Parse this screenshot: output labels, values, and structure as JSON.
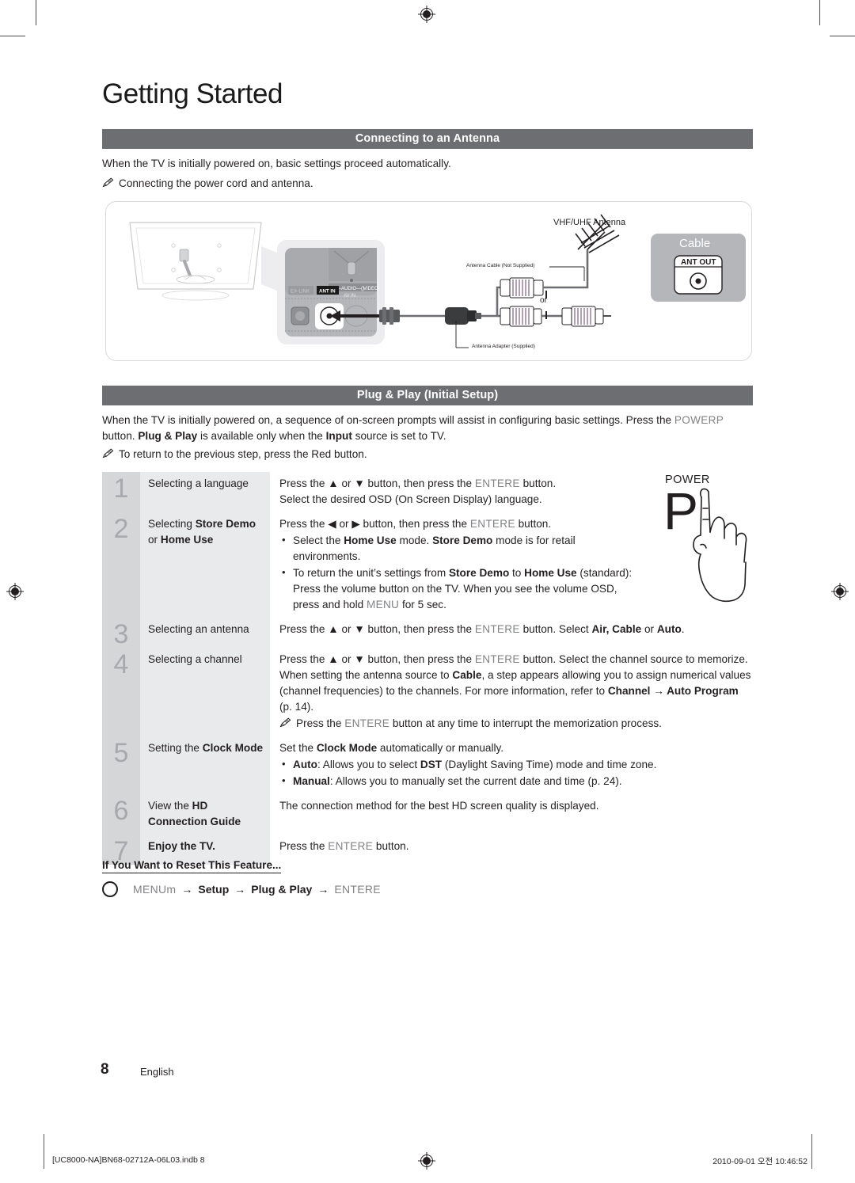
{
  "page": {
    "title": "Getting Started",
    "number": "8",
    "language": "English"
  },
  "antenna_section": {
    "header": "Connecting to an Antenna",
    "intro": "When the TV is initially powered on, basic settings proceed automatically.",
    "note": "Connecting the power cord and antenna.",
    "diagram": {
      "antenna_label": "VHF/UHF Antenna",
      "cable_not_supplied": "Antenna Cable (Not Supplied)",
      "adapter_supplied": "Antenna Adapter (Supplied)",
      "or_label": "or",
      "cable_box_title": "Cable",
      "ant_out_label": "ANT OUT",
      "port_ex_link": "EX-LINK",
      "port_ant_in": "ANT IN",
      "port_audio": "AUDIO",
      "port_video": "VIDEO",
      "port_av_in": "AV IN"
    }
  },
  "plugplay_section": {
    "header": "Plug & Play (Initial Setup)",
    "intro_1": "When the TV is initially powered on, a sequence of on-screen prompts will assist in configuring basic settings. Press the",
    "intro_power_key": "POWERP",
    "intro_2": "button.",
    "intro_bold_plugplay": "Plug & Play",
    "intro_3": "is available only when the",
    "intro_bold_input": "Input",
    "intro_4": "source is set to TV.",
    "note": "To return to the previous step, press the Red button."
  },
  "power_illustration": {
    "label": "POWER",
    "glyph": "P"
  },
  "steps": [
    {
      "num": "1",
      "title_parts": [
        {
          "t": "Selecting a language",
          "b": false
        }
      ],
      "lines": [
        [
          {
            "t": "Press the ",
            "b": false
          },
          {
            "t": "▲",
            "b": false
          },
          {
            "t": " or ",
            "b": false
          },
          {
            "t": "▼",
            "b": false
          },
          {
            "t": " button, then press the ",
            "b": false
          },
          {
            "t": "ENTERE",
            "k": true
          },
          {
            "t": "  button.",
            "b": false
          }
        ],
        [
          {
            "t": "Select the desired OSD (On Screen Display) language.",
            "b": false
          }
        ]
      ],
      "bullets": [],
      "inote": null
    },
    {
      "num": "2",
      "title_parts": [
        {
          "t": "Selecting ",
          "b": false
        },
        {
          "t": "Store Demo",
          "b": true
        },
        {
          "t": " or ",
          "b": false
        },
        {
          "t": "Home Use",
          "b": true
        }
      ],
      "lines": [
        [
          {
            "t": "Press the ",
            "b": false
          },
          {
            "t": "◀",
            "b": false
          },
          {
            "t": " or ",
            "b": false
          },
          {
            "t": "▶",
            "b": false
          },
          {
            "t": " button, then press the ",
            "b": false
          },
          {
            "t": "ENTERE",
            "k": true
          },
          {
            "t": "  button.",
            "b": false
          }
        ]
      ],
      "bullets": [
        [
          {
            "t": "Select the ",
            "b": false
          },
          {
            "t": "Home Use",
            "b": true
          },
          {
            "t": " mode. ",
            "b": false
          },
          {
            "t": "Store Demo",
            "b": true
          },
          {
            "t": " mode is for retail environments.",
            "b": false
          }
        ],
        [
          {
            "t": "To return the unit’s settings from ",
            "b": false
          },
          {
            "t": "Store Demo",
            "b": true
          },
          {
            "t": " to ",
            "b": false
          },
          {
            "t": "Home Use",
            "b": true
          },
          {
            "t": " (standard): Press the volume button on the TV. When you see the volume OSD, press and hold ",
            "b": false
          },
          {
            "t": "MENU",
            "k": true
          },
          {
            "t": " for 5 sec.",
            "b": false
          }
        ]
      ],
      "inote": null
    },
    {
      "num": "3",
      "title_parts": [
        {
          "t": "Selecting an antenna",
          "b": false
        }
      ],
      "lines": [
        [
          {
            "t": "Press the ",
            "b": false
          },
          {
            "t": "▲",
            "b": false
          },
          {
            "t": " or ",
            "b": false
          },
          {
            "t": "▼",
            "b": false
          },
          {
            "t": " button, then press the ",
            "b": false
          },
          {
            "t": "ENTERE",
            "k": true
          },
          {
            "t": "  button. Select ",
            "b": false
          },
          {
            "t": "Air, Cable",
            "b": true
          },
          {
            "t": " or ",
            "b": false
          },
          {
            "t": "Auto",
            "b": true
          },
          {
            "t": ".",
            "b": false
          }
        ]
      ],
      "bullets": [],
      "inote": null
    },
    {
      "num": "4",
      "title_parts": [
        {
          "t": "Selecting a channel",
          "b": false
        }
      ],
      "lines": [
        [
          {
            "t": "Press the ",
            "b": false
          },
          {
            "t": "▲",
            "b": false
          },
          {
            "t": " or ",
            "b": false
          },
          {
            "t": "▼",
            "b": false
          },
          {
            "t": " button, then press the ",
            "b": false
          },
          {
            "t": "ENTERE",
            "k": true
          },
          {
            "t": "  button. Select the channel source to memorize. When setting the antenna source to ",
            "b": false
          },
          {
            "t": "Cable",
            "b": true
          },
          {
            "t": ", a step appears allowing you to assign numerical values (channel frequencies) to the channels. For more information, refer to ",
            "b": false
          },
          {
            "t": "Channel → Auto Program",
            "b": true
          },
          {
            "t": " (p. 14).",
            "b": false
          }
        ]
      ],
      "bullets": [],
      "inote": [
        {
          "t": "Press the ",
          "b": false
        },
        {
          "t": "ENTERE",
          "k": true
        },
        {
          "t": "  button at any time to interrupt the memorization process.",
          "b": false
        }
      ]
    },
    {
      "num": "5",
      "title_parts": [
        {
          "t": "Setting the ",
          "b": false
        },
        {
          "t": "Clock Mode",
          "b": true
        }
      ],
      "lines": [
        [
          {
            "t": "Set the ",
            "b": false
          },
          {
            "t": "Clock Mode",
            "b": true
          },
          {
            "t": " automatically or manually.",
            "b": false
          }
        ]
      ],
      "bullets": [
        [
          {
            "t": "Auto",
            "b": true
          },
          {
            "t": ": Allows you to select ",
            "b": false
          },
          {
            "t": "DST",
            "b": true
          },
          {
            "t": " (Daylight Saving Time) mode and time zone.",
            "b": false
          }
        ],
        [
          {
            "t": "Manual",
            "b": true
          },
          {
            "t": ": Allows you to manually set the current date and time (p. 24).",
            "b": false
          }
        ]
      ],
      "inote": null
    },
    {
      "num": "6",
      "title_parts": [
        {
          "t": "View the ",
          "b": false
        },
        {
          "t": "HD Connection Guide",
          "b": true
        }
      ],
      "lines": [
        [
          {
            "t": "The connection method for the best HD screen quality is displayed.",
            "b": false
          }
        ]
      ],
      "bullets": [],
      "inote": null
    },
    {
      "num": "7",
      "title_parts": [
        {
          "t": "Enjoy the TV.",
          "b": true
        }
      ],
      "lines": [
        [
          {
            "t": "Press the ",
            "b": false
          },
          {
            "t": "ENTERE",
            "k": true
          },
          {
            "t": "  button.",
            "b": false
          }
        ]
      ],
      "bullets": [],
      "inote": null
    }
  ],
  "reset": {
    "heading": "If You Want to Reset This Feature...",
    "path": [
      {
        "t": "MENUm",
        "k": true
      },
      {
        "t": "→",
        "sep": true
      },
      {
        "t": "Setup",
        "b": true
      },
      {
        "t": "→",
        "sep": true
      },
      {
        "t": "Plug & Play",
        "b": true
      },
      {
        "t": "→",
        "sep": true
      },
      {
        "t": "ENTERE",
        "k": true
      }
    ]
  },
  "footer": {
    "file": "[UC8000-NA]BN68-02712A-06L03.indb   8",
    "timestamp": "2010-09-01   오전 10:46:52"
  },
  "colors": {
    "section_bar": "#6d6e71",
    "step_num_bg": "#d4d6d8",
    "step_title_bg": "#e8eaec",
    "key_text": "#808285",
    "body_text": "#231f20"
  }
}
